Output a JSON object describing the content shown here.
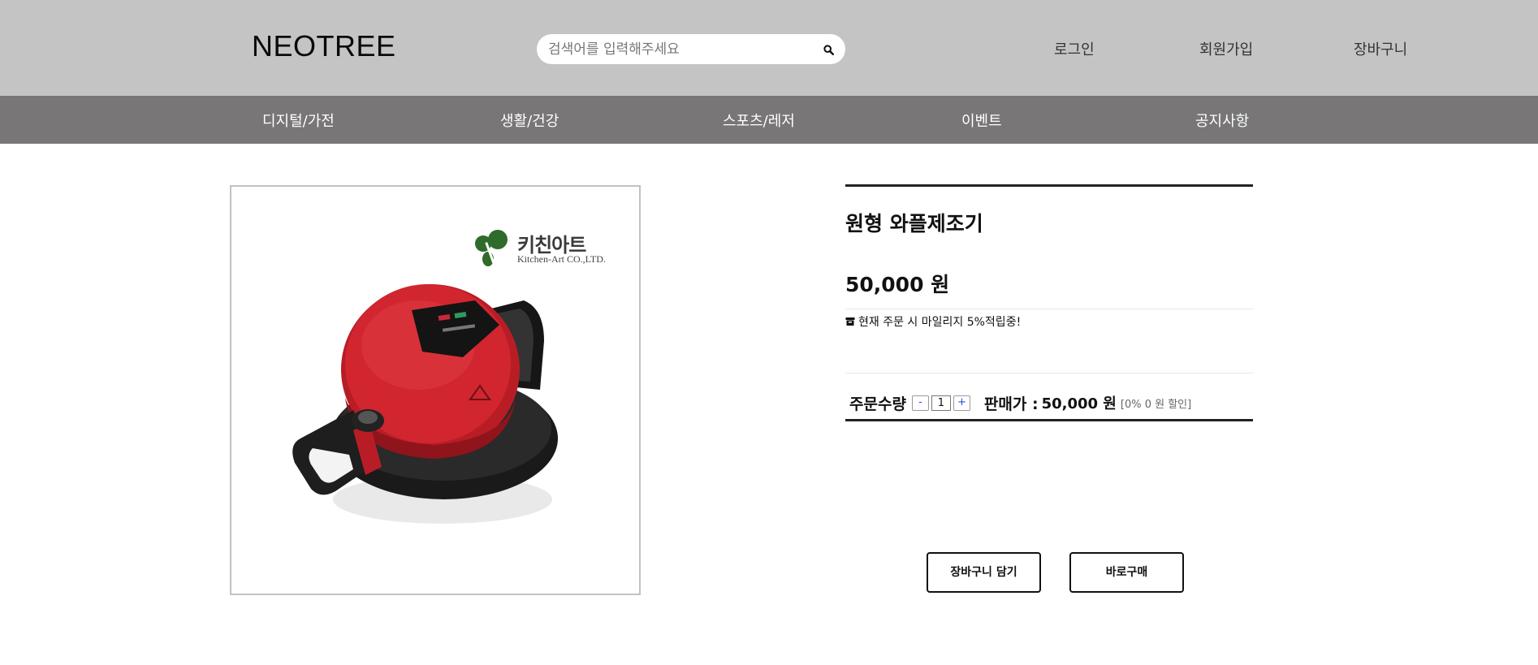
{
  "header": {
    "logo": "NEOTREE",
    "search": {
      "placeholder": "검색어를 입력해주세요",
      "value": ""
    },
    "links": {
      "login": "로그인",
      "signup": "회원가입",
      "cart": "장바구니"
    }
  },
  "nav": {
    "items": [
      "디지털/가전",
      "생활/건강",
      "스포츠/레저",
      "이벤트",
      "공지사항"
    ]
  },
  "product": {
    "brand": {
      "name": "키친아트",
      "sub": "Kitchen-Art CO.,LTD."
    },
    "title": "원형 와플제조기",
    "price": "50,000 원",
    "mileage_text": "현재 주문 시 마일리지 5%적립중!",
    "quantity": {
      "label": "주문수량",
      "minus": "-",
      "value": "1",
      "plus": "+"
    },
    "sale": {
      "label": "판매가 :",
      "price": "50,000 원",
      "discount": "[0% 0 원 할인]"
    },
    "buttons": {
      "add_to_cart": "장바구니 담기",
      "buy_now": "바로구매"
    }
  },
  "colors": {
    "header_bg": "#c4c4c4",
    "nav_bg": "#787676",
    "waffle_red": "#c8202a",
    "brand_green": "#2f6b2a"
  },
  "icons": [
    "search-icon",
    "box-icon"
  ]
}
